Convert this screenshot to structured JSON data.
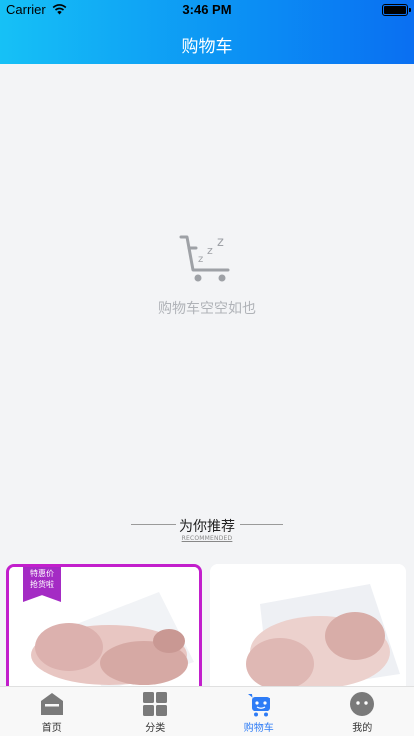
{
  "status_bar": {
    "carrier": "Carrier",
    "time": "3:46 PM"
  },
  "header": {
    "title": "购物车"
  },
  "empty_state": {
    "icon": "empty-cart-icon",
    "message": "购物车空空如也"
  },
  "recommend": {
    "title": "为你推荐",
    "subtitle": "RECOMMENDED"
  },
  "products": [
    {
      "badge_line1": "特惠价",
      "badge_line2": "抢货啦"
    },
    {}
  ],
  "tabs": [
    {
      "label": "首页",
      "icon": "home-icon"
    },
    {
      "label": "分类",
      "icon": "category-icon"
    },
    {
      "label": "购物车",
      "icon": "cart-icon"
    },
    {
      "label": "我的",
      "icon": "profile-icon"
    }
  ],
  "colors": {
    "accent": "#2e7cf6",
    "header_start": "#16c1f6",
    "header_end": "#0a6ff2",
    "badge": "#a42bc4"
  }
}
